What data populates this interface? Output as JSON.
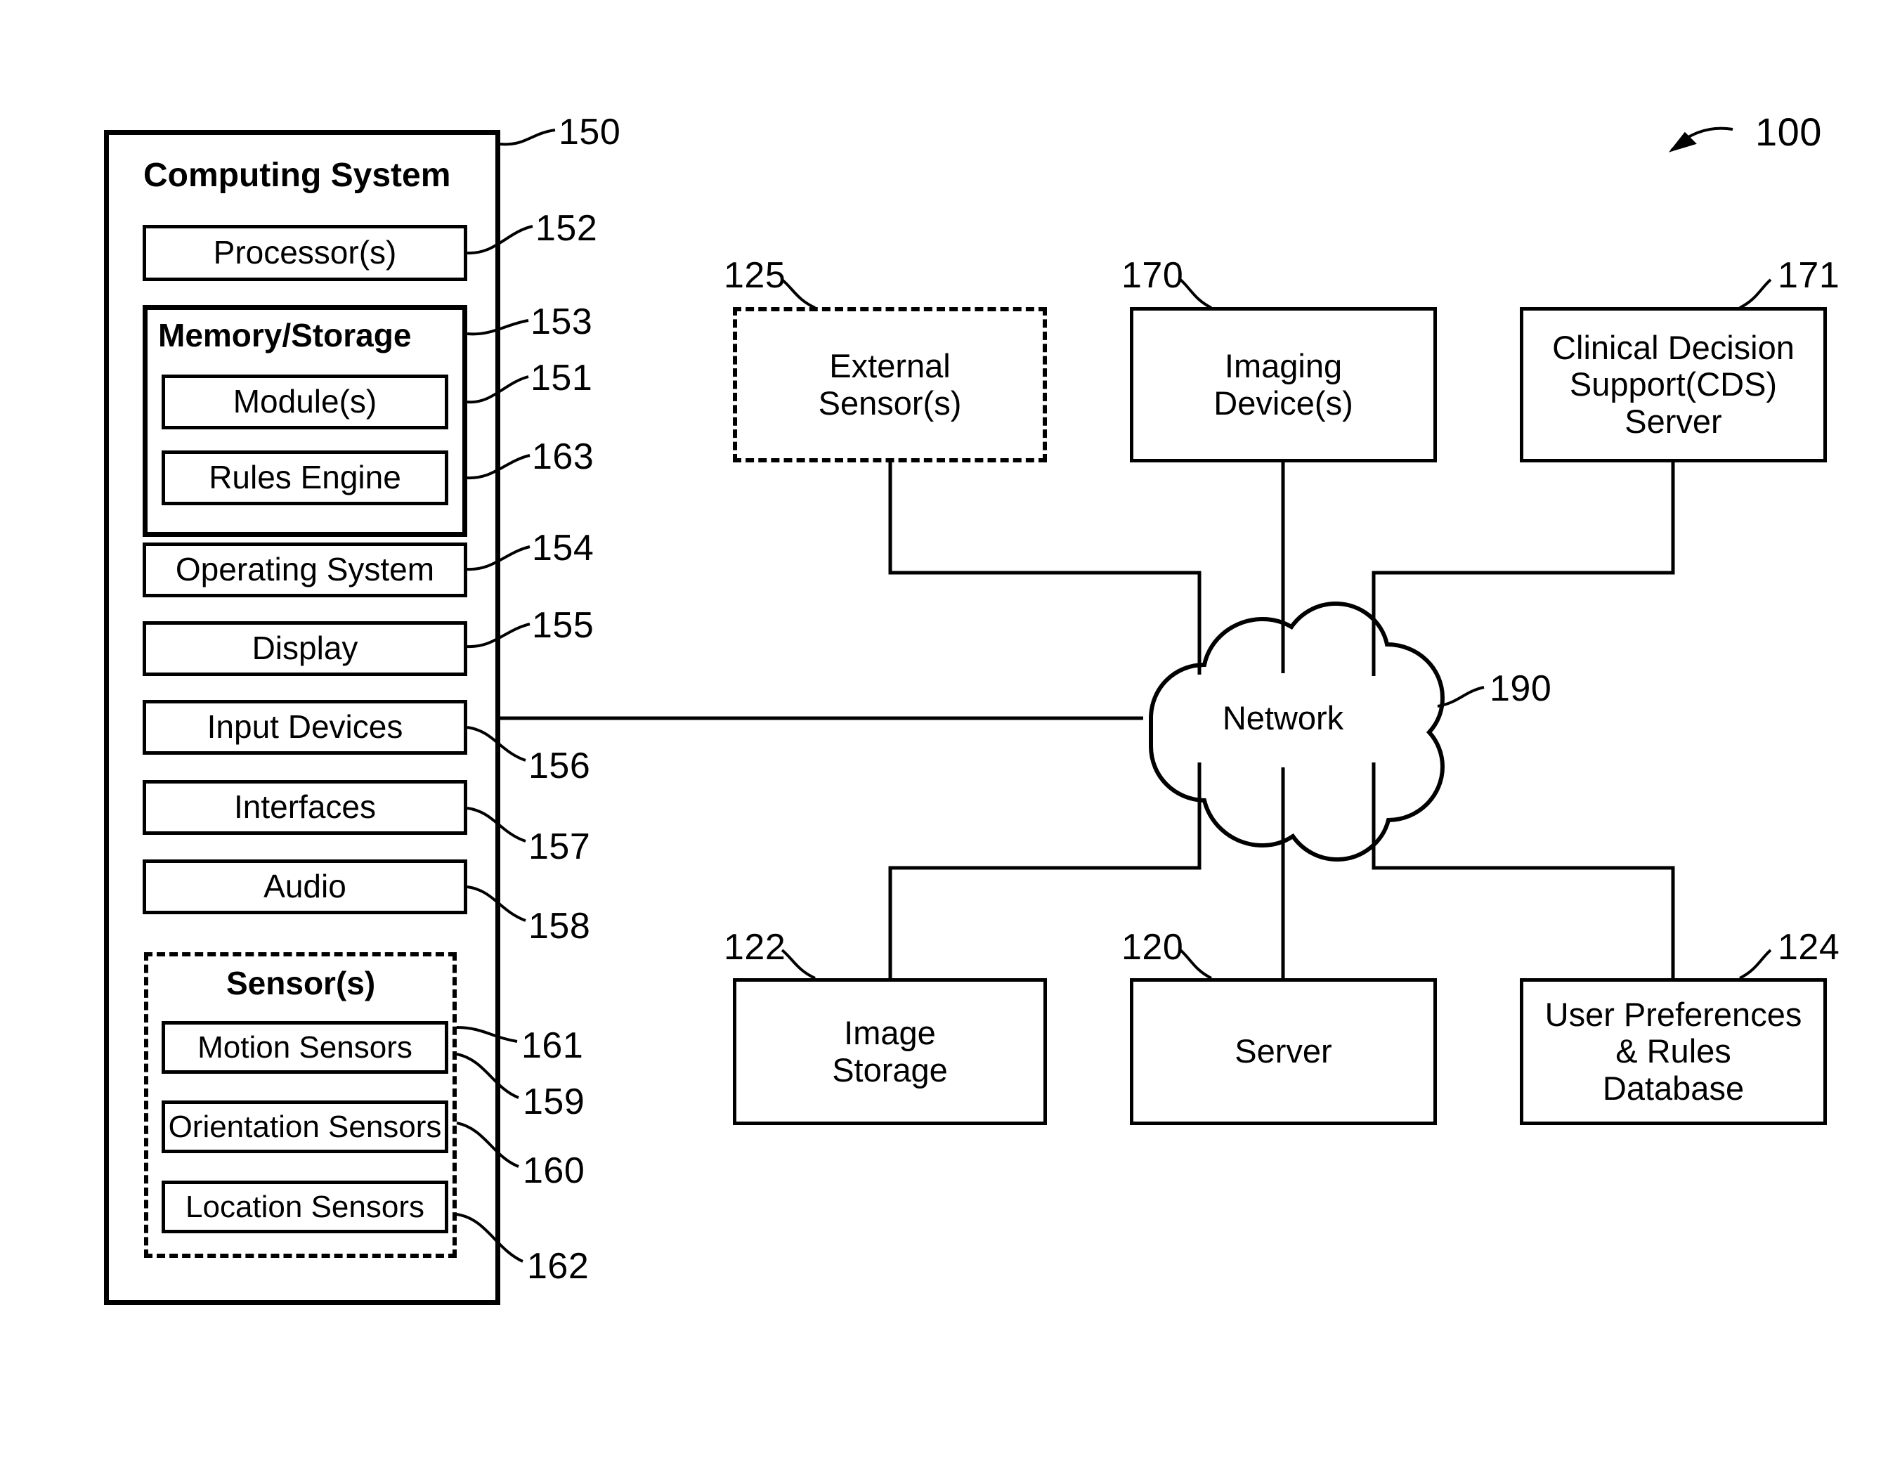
{
  "figure": {
    "label": "100"
  },
  "computing_system": {
    "title": "Computing System",
    "ref": "150",
    "processor": {
      "label": "Processor(s)",
      "ref": "152"
    },
    "memory_storage": {
      "title": "Memory/Storage",
      "ref": "153",
      "modules": {
        "label": "Module(s)",
        "ref": "151"
      },
      "rules_engine": {
        "label": "Rules Engine",
        "ref": "163"
      }
    },
    "operating_system": {
      "label": "Operating System",
      "ref": "154"
    },
    "display": {
      "label": "Display",
      "ref": "155"
    },
    "input_devices": {
      "label": "Input Devices",
      "ref": "156"
    },
    "interfaces": {
      "label": "Interfaces",
      "ref": "157"
    },
    "audio": {
      "label": "Audio",
      "ref": "158"
    },
    "sensors": {
      "title": "Sensor(s)",
      "ref": "159",
      "motion": {
        "label": "Motion Sensors",
        "ref": "161"
      },
      "orientation": {
        "label": "Orientation Sensors",
        "ref": "160"
      },
      "location": {
        "label": "Location Sensors",
        "ref": "162"
      }
    }
  },
  "network": {
    "label": "Network",
    "ref": "190"
  },
  "top_row": [
    {
      "name": "external-sensors",
      "lines": [
        "External",
        "Sensor(s)"
      ],
      "ref": "125",
      "style": "dashed"
    },
    {
      "name": "imaging-devices",
      "lines": [
        "Imaging",
        "Device(s)"
      ],
      "ref": "170",
      "style": "solid"
    },
    {
      "name": "cds-server",
      "lines": [
        "Clinical Decision",
        "Support(CDS)",
        "Server"
      ],
      "ref": "171",
      "style": "solid"
    }
  ],
  "bottom_row": [
    {
      "name": "image-storage",
      "lines": [
        "Image",
        "Storage"
      ],
      "ref": "122",
      "style": "solid"
    },
    {
      "name": "server",
      "lines": [
        "Server"
      ],
      "ref": "120",
      "style": "solid"
    },
    {
      "name": "user-prefs-db",
      "lines": [
        "User Preferences",
        "& Rules",
        "Database"
      ],
      "ref": "124",
      "style": "solid"
    }
  ],
  "colors": {
    "stroke": "#000000",
    "background": "#ffffff"
  }
}
